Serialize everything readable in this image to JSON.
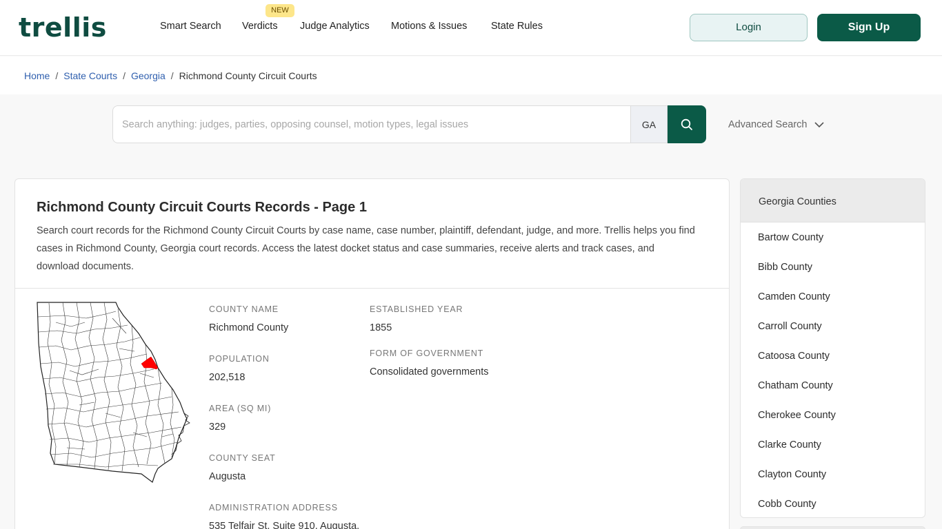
{
  "header": {
    "logo": "trellis",
    "nav": [
      {
        "label": "Smart Search"
      },
      {
        "label": "Verdicts"
      },
      {
        "label": "Judge Analytics"
      },
      {
        "label": "Motions & Issues"
      },
      {
        "label": "State Rules"
      }
    ],
    "new_badge": "NEW",
    "login_label": "Login",
    "signup_label": "Sign Up"
  },
  "breadcrumb": {
    "items": [
      "Home",
      "State Courts",
      "Georgia"
    ],
    "separator": "/",
    "current": "Richmond County Circuit Courts"
  },
  "search": {
    "placeholder": "Search anything: judges, parties, opposing counsel, motion types, legal issues",
    "value": "",
    "state": "GA",
    "advanced_label": "Advanced Search"
  },
  "main": {
    "title": "Richmond County Circuit Courts Records - Page 1",
    "description": "Search court records for the Richmond County Circuit Courts by case name, case number, plaintiff, defendant, judge, and more. Trellis helps you find cases in Richmond County, Georgia court records. Access the latest docket status and case summaries, receive alerts and track cases, and download documents.",
    "fields": {
      "county_name": {
        "label": "COUNTY NAME",
        "value": "Richmond County"
      },
      "population": {
        "label": "POPULATION",
        "value": "202,518"
      },
      "area": {
        "label": "AREA (SQ MI)",
        "value": "329"
      },
      "county_seat": {
        "label": "COUNTY SEAT",
        "value": "Augusta"
      },
      "admin_address": {
        "label": "ADMINISTRATION ADDRESS",
        "value": "535 Telfair St, Suite 910, Augusta,"
      },
      "established": {
        "label": "ESTABLISHED YEAR",
        "value": "1855"
      },
      "government": {
        "label": "FORM OF GOVERNMENT",
        "value": "Consolidated governments"
      }
    },
    "map": {
      "highlight_color": "#ff0000"
    }
  },
  "sidebar": {
    "title": "Georgia Counties",
    "counties": [
      "Bartow County",
      "Bibb County",
      "Camden County",
      "Carroll County",
      "Catoosa County",
      "Chatham County",
      "Cherokee County",
      "Clarke County",
      "Clayton County",
      "Cobb County"
    ]
  },
  "colors": {
    "brand": "#0b5a47",
    "link": "#2f5fae",
    "badge": "#fde68a"
  }
}
